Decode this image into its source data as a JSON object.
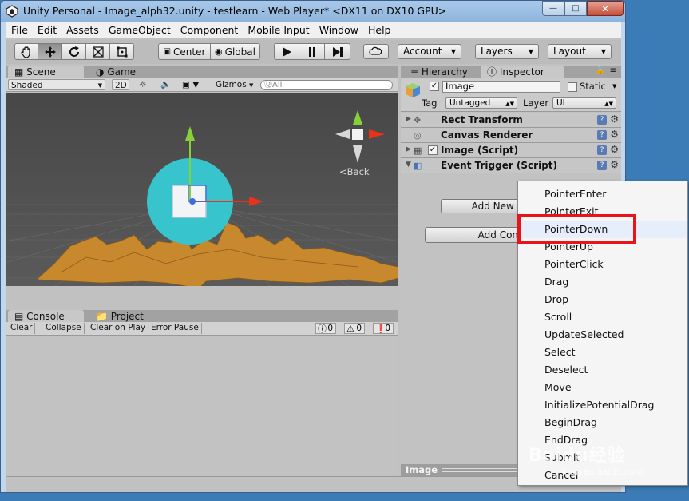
{
  "window": {
    "title": "Unity Personal - Image_alph32.unity - testlearn - Web Player* <DX11 on DX10 GPU>",
    "minimize_glyph": "—",
    "maximize_glyph": "□",
    "close_glyph": "✕"
  },
  "menubar": [
    "File",
    "Edit",
    "Assets",
    "GameObject",
    "Component",
    "Mobile Input",
    "Window",
    "Help"
  ],
  "toolbar": {
    "pivot_label": "Center",
    "space_label": "Global",
    "account_label": "Account",
    "layers_label": "Layers",
    "layout_label": "Layout"
  },
  "scene": {
    "tab_scene": "Scene",
    "tab_game": "Game",
    "shading_mode": "Shaded",
    "mode_2d": "2D",
    "gizmos_label": "Gizmos",
    "search_placeholder": "ⓆAll",
    "orientation_label": "Back"
  },
  "console": {
    "tab_console": "Console",
    "tab_project": "Project",
    "clear_label": "Clear",
    "collapse_label": "Collapse",
    "clear_on_play_label": "Clear on Play",
    "error_pause_label": "Error Pause",
    "info_count": "0",
    "warning_count": "0",
    "error_count": "0"
  },
  "inspector": {
    "tab_hierarchy": "Hierarchy",
    "tab_inspector": "Inspector",
    "object_name": "Image",
    "static_label": "Static",
    "tag_label": "Tag",
    "tag_value": "Untagged",
    "layer_label": "Layer",
    "layer_value": "UI",
    "components": [
      "Rect Transform",
      "Canvas Renderer",
      "Image (Script)",
      "Event Trigger (Script)"
    ],
    "add_event_type_label": "Add New Event Type",
    "add_component_label": "Add Component",
    "preview_label": "Image"
  },
  "event_menu": {
    "items": [
      "PointerEnter",
      "PointerExit",
      "PointerDown",
      "PointerUp",
      "PointerClick",
      "Drag",
      "Drop",
      "Scroll",
      "UpdateSelected",
      "Select",
      "Deselect",
      "Move",
      "InitializePotentialDrag",
      "BeginDrag",
      "EndDrag",
      "Submit",
      "Cancel"
    ],
    "highlighted": "PointerDown"
  },
  "watermark": {
    "brand": "Baidu经验",
    "url": "jingyan.baidu.com"
  },
  "colors": {
    "highlight_box": "#e8141a",
    "scene_circle": "#38c4cc",
    "axis_y": "#86d13a",
    "axis_x": "#e8321c",
    "axis_z": "#3b6fe0",
    "terrain": "#c8882e"
  }
}
